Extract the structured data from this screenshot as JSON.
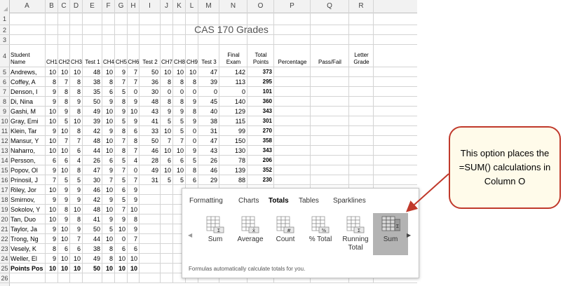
{
  "title": "CAS 170 Grades",
  "columns": [
    "A",
    "B",
    "C",
    "D",
    "E",
    "F",
    "G",
    "H",
    "I",
    "J",
    "K",
    "L",
    "M",
    "N",
    "O",
    "P",
    "Q",
    "R"
  ],
  "header_row": {
    "row_number": "4",
    "A": [
      "Student",
      "Name"
    ],
    "B": [
      "CH1"
    ],
    "C": [
      "CH2"
    ],
    "D": [
      "CH3"
    ],
    "E": [
      "Test 1"
    ],
    "F": [
      "CH4"
    ],
    "G": [
      "CH5"
    ],
    "H": [
      "CH6"
    ],
    "I": [
      "Test 2"
    ],
    "J": [
      "CH7"
    ],
    "K": [
      "CH8"
    ],
    "L": [
      "CH9"
    ],
    "M": [
      "Test 3"
    ],
    "N": [
      "Final",
      "Exam"
    ],
    "O": [
      "Total",
      "Points"
    ],
    "P": [
      "Percentage"
    ],
    "Q": [
      "Pass/Fail"
    ],
    "R": [
      "Letter",
      "Grade"
    ]
  },
  "rows": [
    {
      "n": "5",
      "name": "Andrews,",
      "v": [
        "10",
        "10",
        "10",
        "48",
        "10",
        "9",
        "7",
        "50",
        "10",
        "10",
        "10",
        "47",
        "142",
        "373"
      ]
    },
    {
      "n": "6",
      "name": "Coffey, A",
      "v": [
        "8",
        "7",
        "8",
        "38",
        "8",
        "7",
        "7",
        "36",
        "8",
        "8",
        "8",
        "39",
        "113",
        "295"
      ]
    },
    {
      "n": "7",
      "name": "Denson, I",
      "v": [
        "9",
        "8",
        "8",
        "35",
        "6",
        "5",
        "0",
        "30",
        "0",
        "0",
        "0",
        "0",
        "0",
        "101"
      ]
    },
    {
      "n": "8",
      "name": "Di, Nina",
      "v": [
        "9",
        "8",
        "9",
        "50",
        "9",
        "8",
        "9",
        "48",
        "8",
        "8",
        "9",
        "45",
        "140",
        "360"
      ]
    },
    {
      "n": "9",
      "name": "Gashi, M",
      "v": [
        "10",
        "9",
        "8",
        "49",
        "10",
        "9",
        "10",
        "43",
        "9",
        "9",
        "8",
        "40",
        "129",
        "343"
      ]
    },
    {
      "n": "10",
      "name": "Gray, Emi",
      "v": [
        "10",
        "5",
        "10",
        "39",
        "10",
        "5",
        "9",
        "41",
        "5",
        "5",
        "9",
        "38",
        "115",
        "301"
      ]
    },
    {
      "n": "11",
      "name": "Klein, Tar",
      "v": [
        "9",
        "10",
        "8",
        "42",
        "9",
        "8",
        "6",
        "33",
        "10",
        "5",
        "0",
        "31",
        "99",
        "270"
      ]
    },
    {
      "n": "12",
      "name": "Mansur, Y",
      "v": [
        "10",
        "7",
        "7",
        "48",
        "10",
        "7",
        "8",
        "50",
        "7",
        "7",
        "0",
        "47",
        "150",
        "358"
      ]
    },
    {
      "n": "13",
      "name": "Naharro,",
      "v": [
        "10",
        "10",
        "6",
        "44",
        "10",
        "8",
        "7",
        "46",
        "10",
        "10",
        "9",
        "43",
        "130",
        "343"
      ]
    },
    {
      "n": "14",
      "name": "Persson,",
      "v": [
        "6",
        "6",
        "4",
        "26",
        "6",
        "5",
        "4",
        "28",
        "6",
        "6",
        "5",
        "26",
        "78",
        "206"
      ]
    },
    {
      "n": "15",
      "name": "Popov, Ol",
      "v": [
        "9",
        "10",
        "8",
        "47",
        "9",
        "7",
        "0",
        "49",
        "10",
        "10",
        "8",
        "46",
        "139",
        "352"
      ]
    },
    {
      "n": "16",
      "name": "Prinosil, J",
      "v": [
        "7",
        "5",
        "5",
        "30",
        "7",
        "5",
        "7",
        "31",
        "5",
        "5",
        "6",
        "29",
        "88",
        "230"
      ]
    },
    {
      "n": "17",
      "name": "Riley, Jor",
      "v": [
        "10",
        "9",
        "9",
        "46",
        "10",
        "6",
        "9",
        "",
        "",
        "",
        "",
        "",
        "",
        ""
      ]
    },
    {
      "n": "18",
      "name": "Smirnov,",
      "v": [
        "9",
        "9",
        "9",
        "42",
        "9",
        "5",
        "9",
        "",
        "",
        "",
        "",
        "",
        "",
        ""
      ]
    },
    {
      "n": "19",
      "name": "Sokolov, Y",
      "v": [
        "10",
        "8",
        "10",
        "48",
        "10",
        "7",
        "10",
        "",
        "",
        "",
        "",
        "",
        "",
        ""
      ]
    },
    {
      "n": "20",
      "name": "Tan, Duo",
      "v": [
        "10",
        "9",
        "8",
        "41",
        "9",
        "9",
        "8",
        "",
        "",
        "",
        "",
        "",
        "",
        ""
      ]
    },
    {
      "n": "21",
      "name": "Taylor, Ja",
      "v": [
        "9",
        "10",
        "9",
        "50",
        "5",
        "10",
        "9",
        "",
        "",
        "",
        "",
        "",
        "",
        ""
      ]
    },
    {
      "n": "22",
      "name": "Trong, Ng",
      "v": [
        "9",
        "10",
        "7",
        "44",
        "10",
        "0",
        "7",
        "",
        "",
        "",
        "",
        "",
        "",
        ""
      ]
    },
    {
      "n": "23",
      "name": "Vesely, K",
      "v": [
        "8",
        "6",
        "6",
        "38",
        "8",
        "6",
        "6",
        "",
        "",
        "",
        "",
        "",
        "",
        ""
      ]
    },
    {
      "n": "24",
      "name": "Weller, El",
      "v": [
        "9",
        "10",
        "10",
        "49",
        "8",
        "10",
        "10",
        "",
        "",
        "",
        "",
        "",
        "",
        ""
      ]
    },
    {
      "n": "25",
      "name": "Points Pos",
      "v": [
        "10",
        "10",
        "10",
        "50",
        "10",
        "10",
        "10",
        "",
        "",
        "",
        "",
        "",
        "",
        ""
      ]
    },
    {
      "n": "26",
      "name": "",
      "v": [
        "",
        "",
        "",
        "",
        "",
        "",
        "",
        "",
        "",
        "",
        "",
        "",
        "",
        ""
      ]
    }
  ],
  "quick_analysis": {
    "tabs": [
      "Formatting",
      "Charts",
      "Totals",
      "Tables",
      "Sparklines"
    ],
    "active_tab": "Totals",
    "buttons": [
      {
        "label": "Sum",
        "glyph": "Σ"
      },
      {
        "label": "Average",
        "glyph": "x̄"
      },
      {
        "label": "Count",
        "glyph": "#"
      },
      {
        "label": "% Total",
        "glyph": "%"
      },
      {
        "label": "Running Total",
        "glyph": "Σ"
      },
      {
        "label": "Sum",
        "glyph": "Σ"
      }
    ],
    "selected_index": 5,
    "footer": "Formulas automatically calculate totals for you."
  },
  "callout": {
    "text": "This option places the =SUM() calculations in Column O",
    "border_color": "#c0392b",
    "fill_color": "#fffbea",
    "arrow_color": "#c0392b"
  }
}
